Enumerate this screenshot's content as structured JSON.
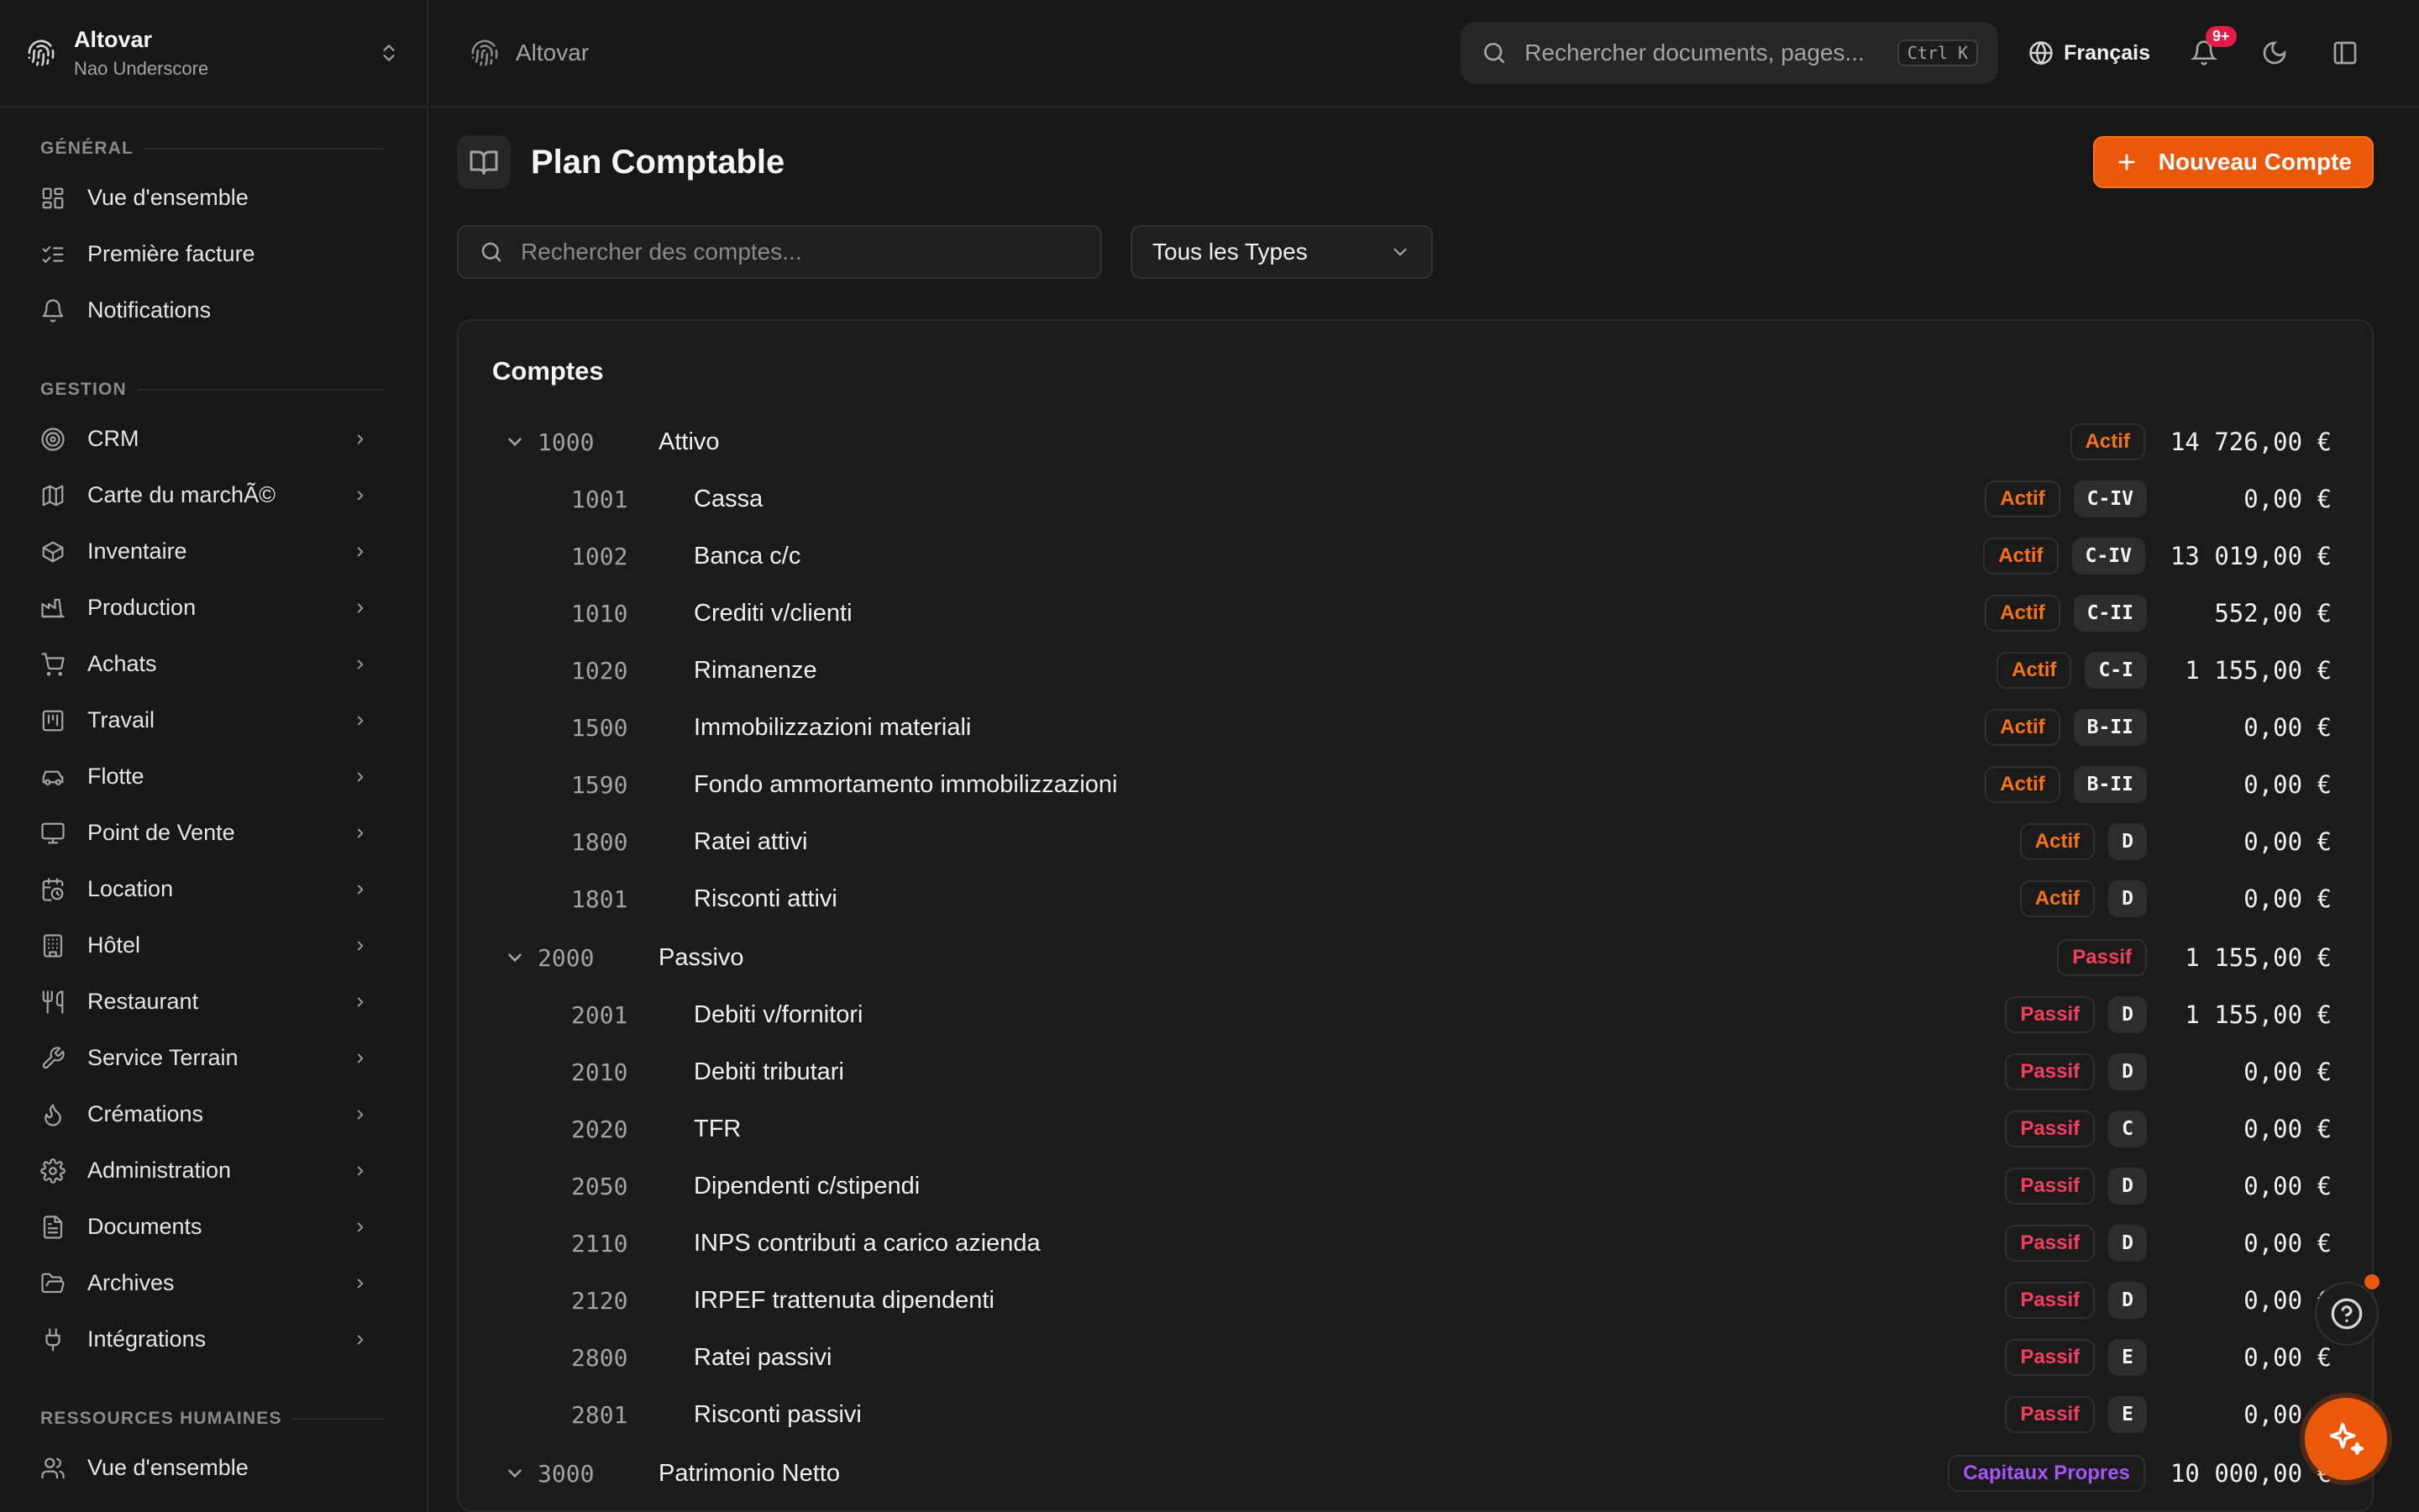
{
  "org": {
    "name": "Altovar",
    "subtitle": "Nao Underscore"
  },
  "sidebar": {
    "sections": [
      {
        "title": "GÉNÉRAL",
        "items": [
          {
            "label": "Vue d'ensemble",
            "icon": "dashboard-icon"
          },
          {
            "label": "Première facture",
            "icon": "checklist-icon"
          },
          {
            "label": "Notifications",
            "icon": "bell-icon"
          }
        ]
      },
      {
        "title": "GESTION",
        "items": [
          {
            "label": "CRM",
            "icon": "target-icon"
          },
          {
            "label": "Carte du marchÃ©",
            "icon": "map-icon"
          },
          {
            "label": "Inventaire",
            "icon": "box-icon"
          },
          {
            "label": "Production",
            "icon": "factory-icon"
          },
          {
            "label": "Achats",
            "icon": "cart-icon"
          },
          {
            "label": "Travail",
            "icon": "kanban-icon"
          },
          {
            "label": "Flotte",
            "icon": "car-icon"
          },
          {
            "label": "Point de Vente",
            "icon": "monitor-icon"
          },
          {
            "label": "Location",
            "icon": "calendar-clock-icon"
          },
          {
            "label": "Hôtel",
            "icon": "building-icon"
          },
          {
            "label": "Restaurant",
            "icon": "utensils-icon"
          },
          {
            "label": "Service Terrain",
            "icon": "wrench-icon"
          },
          {
            "label": "Crémations",
            "icon": "flame-icon"
          },
          {
            "label": "Administration",
            "icon": "gear-icon"
          },
          {
            "label": "Documents",
            "icon": "file-icon"
          },
          {
            "label": "Archives",
            "icon": "folder-open-icon"
          },
          {
            "label": "Intégrations",
            "icon": "plug-icon"
          }
        ]
      },
      {
        "title": "RESSOURCES HUMAINES",
        "items": [
          {
            "label": "Vue d'ensemble",
            "icon": "users-icon"
          }
        ]
      }
    ]
  },
  "topbar": {
    "breadcrumb": "Altovar",
    "search_placeholder": "Rechercher documents, pages...",
    "search_shortcut": "Ctrl K",
    "language": "Français",
    "notifications_badge": "9+"
  },
  "page": {
    "title": "Plan Comptable",
    "new_button": "Nouveau Compte",
    "search_placeholder": "Rechercher des comptes...",
    "type_filter": "Tous les Types",
    "card_title": "Comptes"
  },
  "accounts": [
    {
      "level": "parent",
      "code": "1000",
      "name": "Attivo",
      "type": "Actif",
      "type_class": "actif",
      "cls": "",
      "balance": "14 726,00 €"
    },
    {
      "level": "child",
      "code": "1001",
      "name": "Cassa",
      "type": "Actif",
      "type_class": "actif",
      "cls": "C-IV",
      "balance": "0,00 €"
    },
    {
      "level": "child",
      "code": "1002",
      "name": "Banca c/c",
      "type": "Actif",
      "type_class": "actif",
      "cls": "C-IV",
      "balance": "13 019,00 €"
    },
    {
      "level": "child",
      "code": "1010",
      "name": "Crediti v/clienti",
      "type": "Actif",
      "type_class": "actif",
      "cls": "C-II",
      "balance": "552,00 €"
    },
    {
      "level": "child",
      "code": "1020",
      "name": "Rimanenze",
      "type": "Actif",
      "type_class": "actif",
      "cls": "C-I",
      "balance": "1 155,00 €"
    },
    {
      "level": "child",
      "code": "1500",
      "name": "Immobilizzazioni materiali",
      "type": "Actif",
      "type_class": "actif",
      "cls": "B-II",
      "balance": "0,00 €"
    },
    {
      "level": "child",
      "code": "1590",
      "name": "Fondo ammortamento immobilizzazioni",
      "type": "Actif",
      "type_class": "actif",
      "cls": "B-II",
      "balance": "0,00 €"
    },
    {
      "level": "child",
      "code": "1800",
      "name": "Ratei attivi",
      "type": "Actif",
      "type_class": "actif",
      "cls": "D",
      "balance": "0,00 €"
    },
    {
      "level": "child",
      "code": "1801",
      "name": "Risconti attivi",
      "type": "Actif",
      "type_class": "actif",
      "cls": "D",
      "balance": "0,00 €"
    },
    {
      "level": "parent",
      "code": "2000",
      "name": "Passivo",
      "type": "Passif",
      "type_class": "passif",
      "cls": "",
      "balance": "1 155,00 €"
    },
    {
      "level": "child",
      "code": "2001",
      "name": "Debiti v/fornitori",
      "type": "Passif",
      "type_class": "passif",
      "cls": "D",
      "balance": "1 155,00 €"
    },
    {
      "level": "child",
      "code": "2010",
      "name": "Debiti tributari",
      "type": "Passif",
      "type_class": "passif",
      "cls": "D",
      "balance": "0,00 €"
    },
    {
      "level": "child",
      "code": "2020",
      "name": "TFR",
      "type": "Passif",
      "type_class": "passif",
      "cls": "C",
      "balance": "0,00 €"
    },
    {
      "level": "child",
      "code": "2050",
      "name": "Dipendenti c/stipendi",
      "type": "Passif",
      "type_class": "passif",
      "cls": "D",
      "balance": "0,00 €"
    },
    {
      "level": "child",
      "code": "2110",
      "name": "INPS contributi a carico azienda",
      "type": "Passif",
      "type_class": "passif",
      "cls": "D",
      "balance": "0,00 €"
    },
    {
      "level": "child",
      "code": "2120",
      "name": "IRPEF trattenuta dipendenti",
      "type": "Passif",
      "type_class": "passif",
      "cls": "D",
      "balance": "0,00 €"
    },
    {
      "level": "child",
      "code": "2800",
      "name": "Ratei passivi",
      "type": "Passif",
      "type_class": "passif",
      "cls": "E",
      "balance": "0,00 €"
    },
    {
      "level": "child",
      "code": "2801",
      "name": "Risconti passivi",
      "type": "Passif",
      "type_class": "passif",
      "cls": "E",
      "balance": "0,00 €"
    },
    {
      "level": "parent",
      "code": "3000",
      "name": "Patrimonio Netto",
      "type": "Capitaux Propres",
      "type_class": "capitaux",
      "cls": "",
      "balance": "10 000,00 €"
    }
  ],
  "colors": {
    "accent": "#ea580c",
    "actif": "#f97316",
    "passif": "#f43f5e",
    "capitaux": "#a855f7"
  }
}
